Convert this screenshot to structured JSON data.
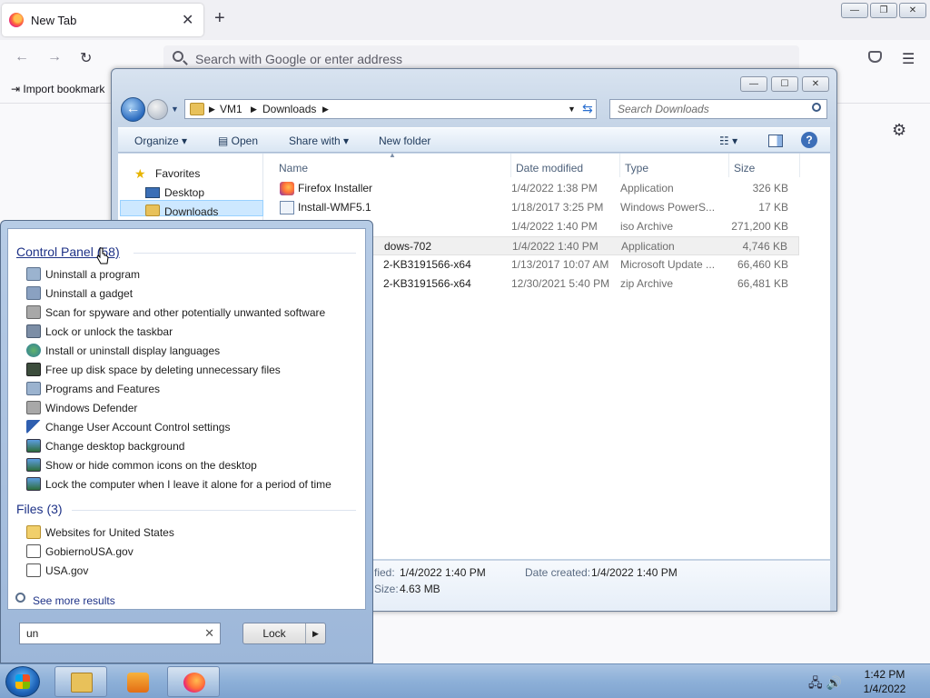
{
  "firefox": {
    "tab_title": "New Tab",
    "tab_close": "✕",
    "new_tab": "+",
    "url_placeholder": "Search with Google or enter address",
    "bookmark_import": "Import bookmark",
    "back": "←",
    "forward": "→",
    "reload": "↻",
    "menu": "☰",
    "gear": "⚙",
    "window_buttons": [
      "—",
      "❐",
      "✕"
    ]
  },
  "explorer": {
    "window_buttons": [
      "—",
      "☐",
      "✕"
    ],
    "breadcrumb": [
      "VM1",
      "Downloads"
    ],
    "search_placeholder": "Search Downloads",
    "toolbar": {
      "organize": "Organize",
      "open": "Open",
      "share_with": "Share with",
      "new_folder": "New folder"
    },
    "nav": {
      "favorites": "Favorites",
      "desktop": "Desktop",
      "downloads": "Downloads"
    },
    "columns": [
      "Name",
      "Date modified",
      "Type",
      "Size"
    ],
    "files": [
      {
        "name": "Firefox Installer",
        "date": "1/4/2022 1:38 PM",
        "type": "Application",
        "size": "326 KB"
      },
      {
        "name": "Install-WMF5.1",
        "date": "1/18/2017 3:25 PM",
        "type": "Windows PowerS...",
        "size": "17 KB"
      },
      {
        "name": "",
        "date": "1/4/2022 1:40 PM",
        "type": "iso Archive",
        "size": "271,200 KB"
      },
      {
        "name": "dows-702",
        "date": "1/4/2022 1:40 PM",
        "type": "Application",
        "size": "4,746 KB"
      },
      {
        "name": "2-KB3191566-x64",
        "date": "1/13/2017 10:07 AM",
        "type": "Microsoft Update ...",
        "size": "66,460 KB"
      },
      {
        "name": "2-KB3191566-x64",
        "date": "12/30/2021 5:40 PM",
        "type": "zip Archive",
        "size": "66,481 KB"
      }
    ],
    "details": {
      "modified_label": "fied:",
      "modified_value": "1/4/2022 1:40 PM",
      "created_label": "Date created:",
      "created_value": "1/4/2022 1:40 PM",
      "size_label": "Size:",
      "size_value": "4.63 MB"
    }
  },
  "start_menu": {
    "control_panel_heading": "Control Panel (58)",
    "control_panel_items": [
      "Uninstall a program",
      "Uninstall a gadget",
      "Scan for spyware and other potentially unwanted software",
      "Lock or unlock the taskbar",
      "Install or uninstall display languages",
      "Free up disk space by deleting unnecessary files",
      "Programs and Features",
      "Windows Defender",
      "Change User Account Control settings",
      "Change desktop background",
      "Show or hide common icons on the desktop",
      "Lock the computer when I leave it alone for a period of time"
    ],
    "files_heading": "Files (3)",
    "file_items": [
      "Websites for United States",
      "GobiernoUSA.gov",
      "USA.gov"
    ],
    "see_more": "See more results",
    "search_value": "un",
    "clear": "✕",
    "lock_button": "Lock",
    "lock_arrow": "▶"
  },
  "taskbar": {
    "time": "1:42 PM",
    "date": "1/4/2022"
  }
}
